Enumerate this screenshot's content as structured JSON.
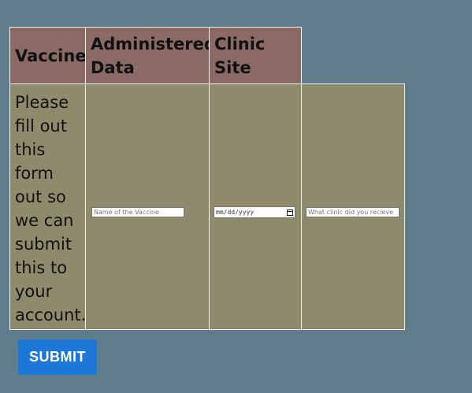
{
  "table": {
    "headers": [
      "Vaccine",
      "Administered Data",
      "Clinic Site"
    ],
    "instruction": "Please fill out this form out so we can submit this to your account.",
    "inputs": {
      "vaccine_placeholder": "Name of the Vaccine",
      "date_placeholder": "mm/dd/yyyy",
      "clinic_placeholder": "What clinic did you recieve"
    }
  },
  "form": {
    "submit_label": "SUBMIT"
  },
  "colors": {
    "background": "#5f7d8c",
    "header_fill": "#8b6a66",
    "body_fill": "#8e8b6c",
    "submit_fill": "#1d77d6"
  },
  "icons": [
    "calendar-icon"
  ]
}
